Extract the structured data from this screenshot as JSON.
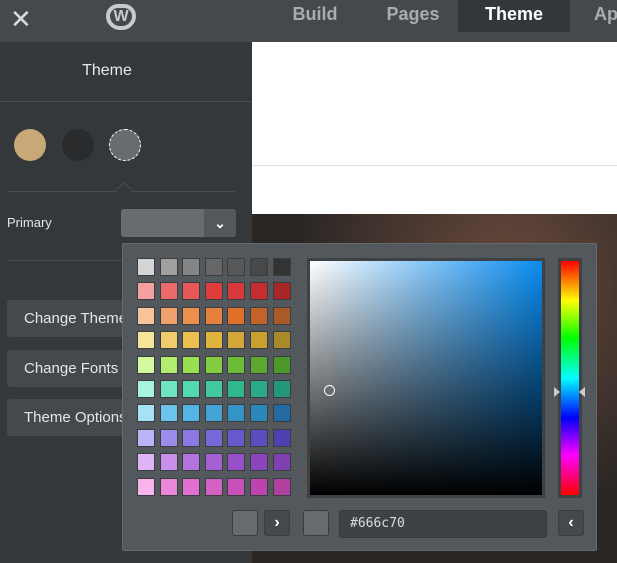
{
  "topbar": {
    "close_icon": "close-icon",
    "logo": "W",
    "tabs": [
      {
        "label": "Build"
      },
      {
        "label": "Pages"
      },
      {
        "label": "Theme",
        "active": true
      },
      {
        "label": "Apps"
      }
    ]
  },
  "sidebar": {
    "title": "Theme",
    "swatches": [
      "#c9a878",
      "#2a2b2c",
      "#666c70"
    ],
    "primary_label": "Primary",
    "primary_value": "#666c70",
    "buttons": [
      {
        "label": "Change Theme"
      },
      {
        "label": "Change Fonts"
      },
      {
        "label": "Theme Options"
      }
    ]
  },
  "picker": {
    "hex_value": "#666c70",
    "base_hue": "#0a8cf0",
    "palette": [
      [
        "#d4d4d4",
        "#a0a0a0",
        "#858585",
        "#666666",
        "#585858",
        "#484848",
        "#333333"
      ],
      [
        "#f5a0a0",
        "#ec6a6a",
        "#e85858",
        "#e03c3c",
        "#d63a3a",
        "#c42e2e",
        "#a82626"
      ],
      [
        "#f8c49c",
        "#f0a06c",
        "#ec9050",
        "#e6803c",
        "#e07028",
        "#c4622a",
        "#a85a28"
      ],
      [
        "#f8e498",
        "#f0cc6c",
        "#ecc050",
        "#e0b43c",
        "#d4a838",
        "#c8a030",
        "#a88a2a"
      ],
      [
        "#d4f8a0",
        "#b4ec70",
        "#98e050",
        "#84cc40",
        "#6cbc38",
        "#5ca830",
        "#4c9828"
      ],
      [
        "#a8f4e0",
        "#70e4c0",
        "#54d8b0",
        "#44c8a0",
        "#30b88c",
        "#2ca88a",
        "#24967a"
      ],
      [
        "#a8e0f8",
        "#6cc4ec",
        "#54b4e4",
        "#44a4d4",
        "#3494c8",
        "#2c88b8",
        "#246aa0"
      ],
      [
        "#bcb4f8",
        "#9c8cec",
        "#8c78e4",
        "#7868d8",
        "#6858cc",
        "#5c4cc0",
        "#5040b0"
      ],
      [
        "#e0b4f8",
        "#c890ec",
        "#b474e0",
        "#a460d4",
        "#9850c8",
        "#8c44bc",
        "#8040b0"
      ],
      [
        "#f8b4ec",
        "#ec88dc",
        "#e070d0",
        "#d460c4",
        "#c850b8",
        "#bc44ac",
        "#b040a0"
      ]
    ]
  }
}
